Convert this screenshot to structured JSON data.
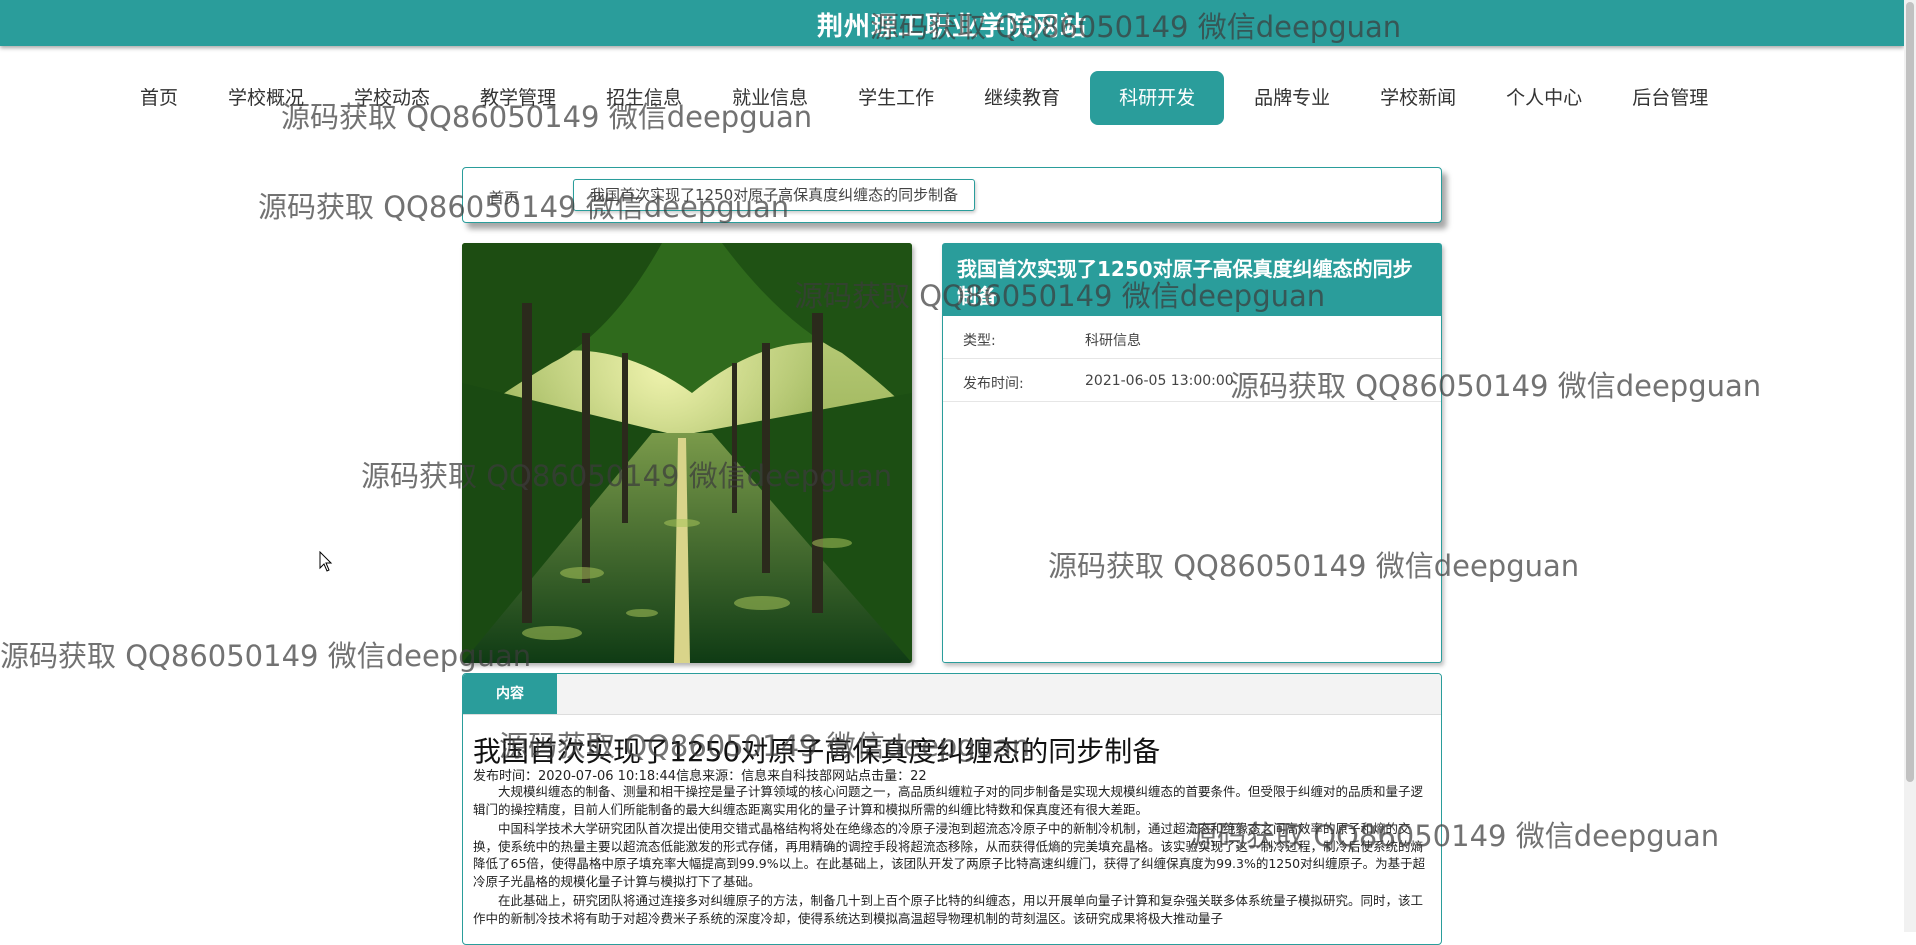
{
  "header": {
    "site_title": "荆州理工职业学院网站"
  },
  "nav": {
    "items": [
      "首页",
      "学校概况",
      "学校动态",
      "教学管理",
      "招生信息",
      "就业信息",
      "学生工作",
      "继续教育",
      "科研开发",
      "品牌专业",
      "学校新闻",
      "个人中心",
      "后台管理"
    ],
    "active": "科研开发"
  },
  "breadcrumb": {
    "home": "首页",
    "current": "我国首次实现了1250对原子高保真度纠缠态的同步制备"
  },
  "detail": {
    "title": "我国首次实现了1250对原子高保真度纠缠态的同步制备",
    "type_label": "类型:",
    "type_value": "科研信息",
    "time_label": "发布时间:",
    "time_value": "2021-06-05 13:00:00"
  },
  "content": {
    "tab_label": "内容",
    "article_title": "我国首次实现了1250对原子高保真度纠缠态的同步制备",
    "meta": "发布时间：2020-07-06 10:18:44信息来源：信息来自科技部网站点击量：22",
    "paragraphs": [
      "大规模纠缠态的制备、测量和相干操控是量子计算领域的核心问题之一，高品质纠缠粒子对的同步制备是实现大规模纠缠态的首要条件。但受限于纠缠对的品质和量子逻辑门的操控精度，目前人们所能制备的最大纠缠态距离实用化的量子计算和模拟所需的纠缠比特数和保真度还有很大差距。",
      "中国科学技术大学研究团队首次提出使用交错式晶格结构将处在绝缘态的冷原子浸泡到超流态冷原子中的新制冷机制，通过超流态和绝缘态之间高效率的原子和熵的交换，使系统中的热量主要以超流态低能激发的形式存储，再用精确的调控手段将超流态移除，从而获得低熵的完美填充晶格。该实验实现了这一制冷过程，制冷后使系统的熵降低了65倍，使得晶格中原子填充率大幅提高到99.9%以上。在此基础上，该团队开发了两原子比特高速纠缠门，获得了纠缠保真度为99.3%的1250对纠缠原子。为基于超冷原子光晶格的规模化量子计算与模拟打下了基础。",
      "在此基础上，研究团队将通过连接多对纠缠原子的方法，制备几十到上百个原子比特的纠缠态，用以开展单向量子计算和复杂强关联多体系统量子模拟研究。同时，该工作中的新制冷技术将有助于对超冷费米子系统的深度冷却，使得系统达到模拟高温超导物理机制的苛刻温区。该研究成果将极大推动量子"
    ]
  },
  "watermark": "源码获取 QQ86050149 微信deepguan",
  "colors": {
    "accent": "#2a9d9b"
  }
}
